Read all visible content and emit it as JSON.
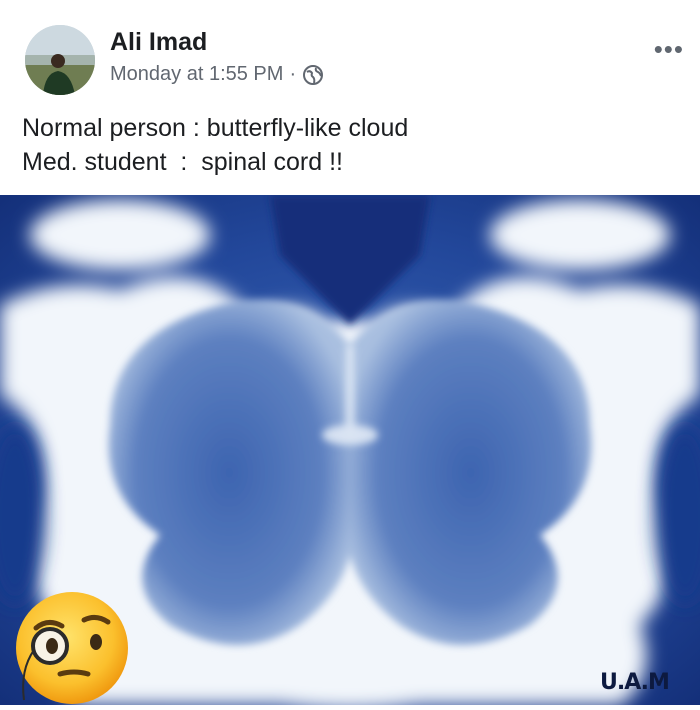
{
  "post": {
    "author": "Ali Imad",
    "timestamp": "Monday at 1:55 PM",
    "separator": "·",
    "privacy_icon": "globe-icon",
    "more_label": "•••",
    "caption_lines": [
      "Normal person : butterfly-like cloud",
      "Med. student  :  spinal cord !!"
    ]
  },
  "photo": {
    "watermark": "U.A.M",
    "emoji": "face-with-monocle-emoji"
  },
  "colors": {
    "sky": "#1f3f8a",
    "cloud": "#f4f7fb",
    "text_secondary": "#616770"
  }
}
